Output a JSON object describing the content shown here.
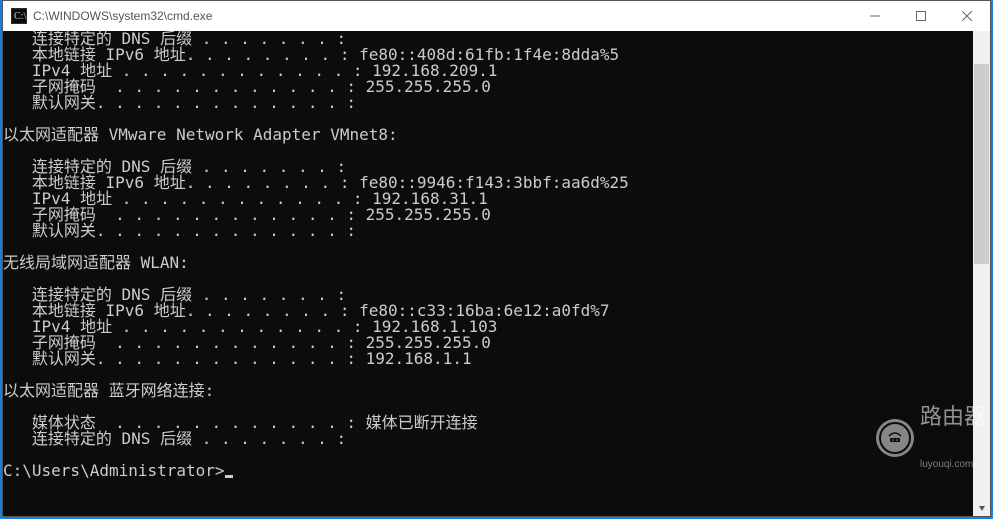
{
  "window": {
    "title": "C:\\WINDOWS\\system32\\cmd.exe"
  },
  "console": {
    "lines": [
      "   连接特定的 DNS 后缀 . . . . . . . :",
      "   本地链接 IPv6 地址. . . . . . . . : fe80::408d:61fb:1f4e:8dda%5",
      "   IPv4 地址 . . . . . . . . . . . . : 192.168.209.1",
      "   子网掩码  . . . . . . . . . . . . : 255.255.255.0",
      "   默认网关. . . . . . . . . . . . . :",
      "",
      "以太网适配器 VMware Network Adapter VMnet8:",
      "",
      "   连接特定的 DNS 后缀 . . . . . . . :",
      "   本地链接 IPv6 地址. . . . . . . . : fe80::9946:f143:3bbf:aa6d%25",
      "   IPv4 地址 . . . . . . . . . . . . : 192.168.31.1",
      "   子网掩码  . . . . . . . . . . . . : 255.255.255.0",
      "   默认网关. . . . . . . . . . . . . :",
      "",
      "无线局域网适配器 WLAN:",
      "",
      "   连接特定的 DNS 后缀 . . . . . . . :",
      "   本地链接 IPv6 地址. . . . . . . . : fe80::c33:16ba:6e12:a0fd%7",
      "   IPv4 地址 . . . . . . . . . . . . : 192.168.1.103",
      "   子网掩码  . . . . . . . . . . . . : 255.255.255.0",
      "   默认网关. . . . . . . . . . . . . : 192.168.1.1",
      "",
      "以太网适配器 蓝牙网络连接:",
      "",
      "   媒体状态  . . . . . . . . . . . . : 媒体已断开连接",
      "   连接特定的 DNS 后缀 . . . . . . . :",
      "",
      "C:\\Users\\Administrator>"
    ]
  },
  "watermark": {
    "main": "路由器",
    "sub": "luyouqi.com"
  }
}
